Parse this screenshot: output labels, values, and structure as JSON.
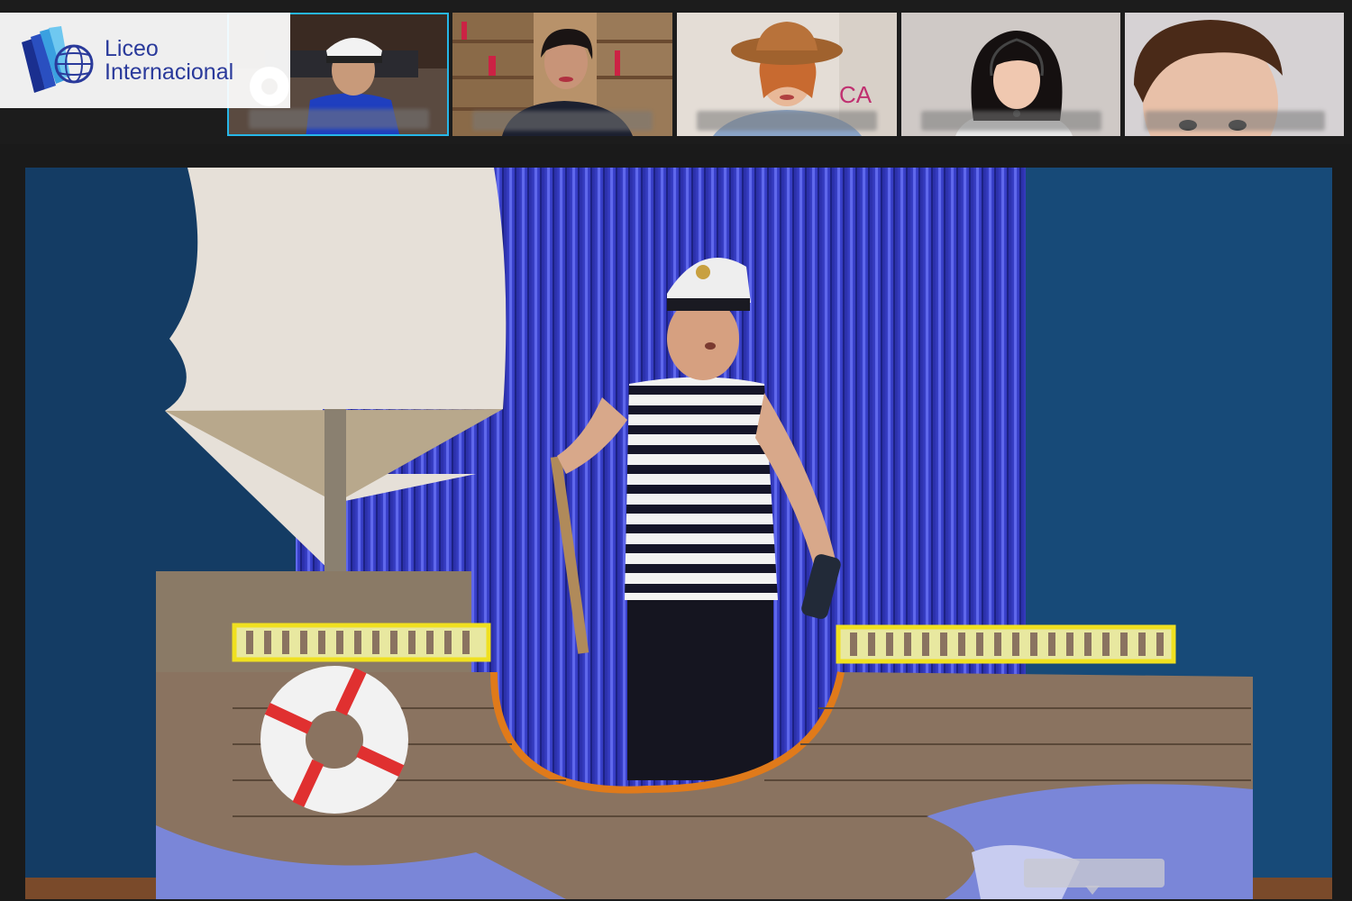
{
  "branding": {
    "line1": "Liceo",
    "line2": "Internacional",
    "brand_color": "#2a3a9b",
    "icon": "book-globe-logo-icon"
  },
  "gallery": {
    "active_tile": 1,
    "tiles": [
      {
        "name": ""
      },
      {
        "name": ""
      },
      {
        "name": ""
      },
      {
        "name": ""
      },
      {
        "name": ""
      }
    ]
  },
  "colors": {
    "active_border": "#27b7e8",
    "wall": "#143c64",
    "curtain": "#3a3fc8"
  }
}
